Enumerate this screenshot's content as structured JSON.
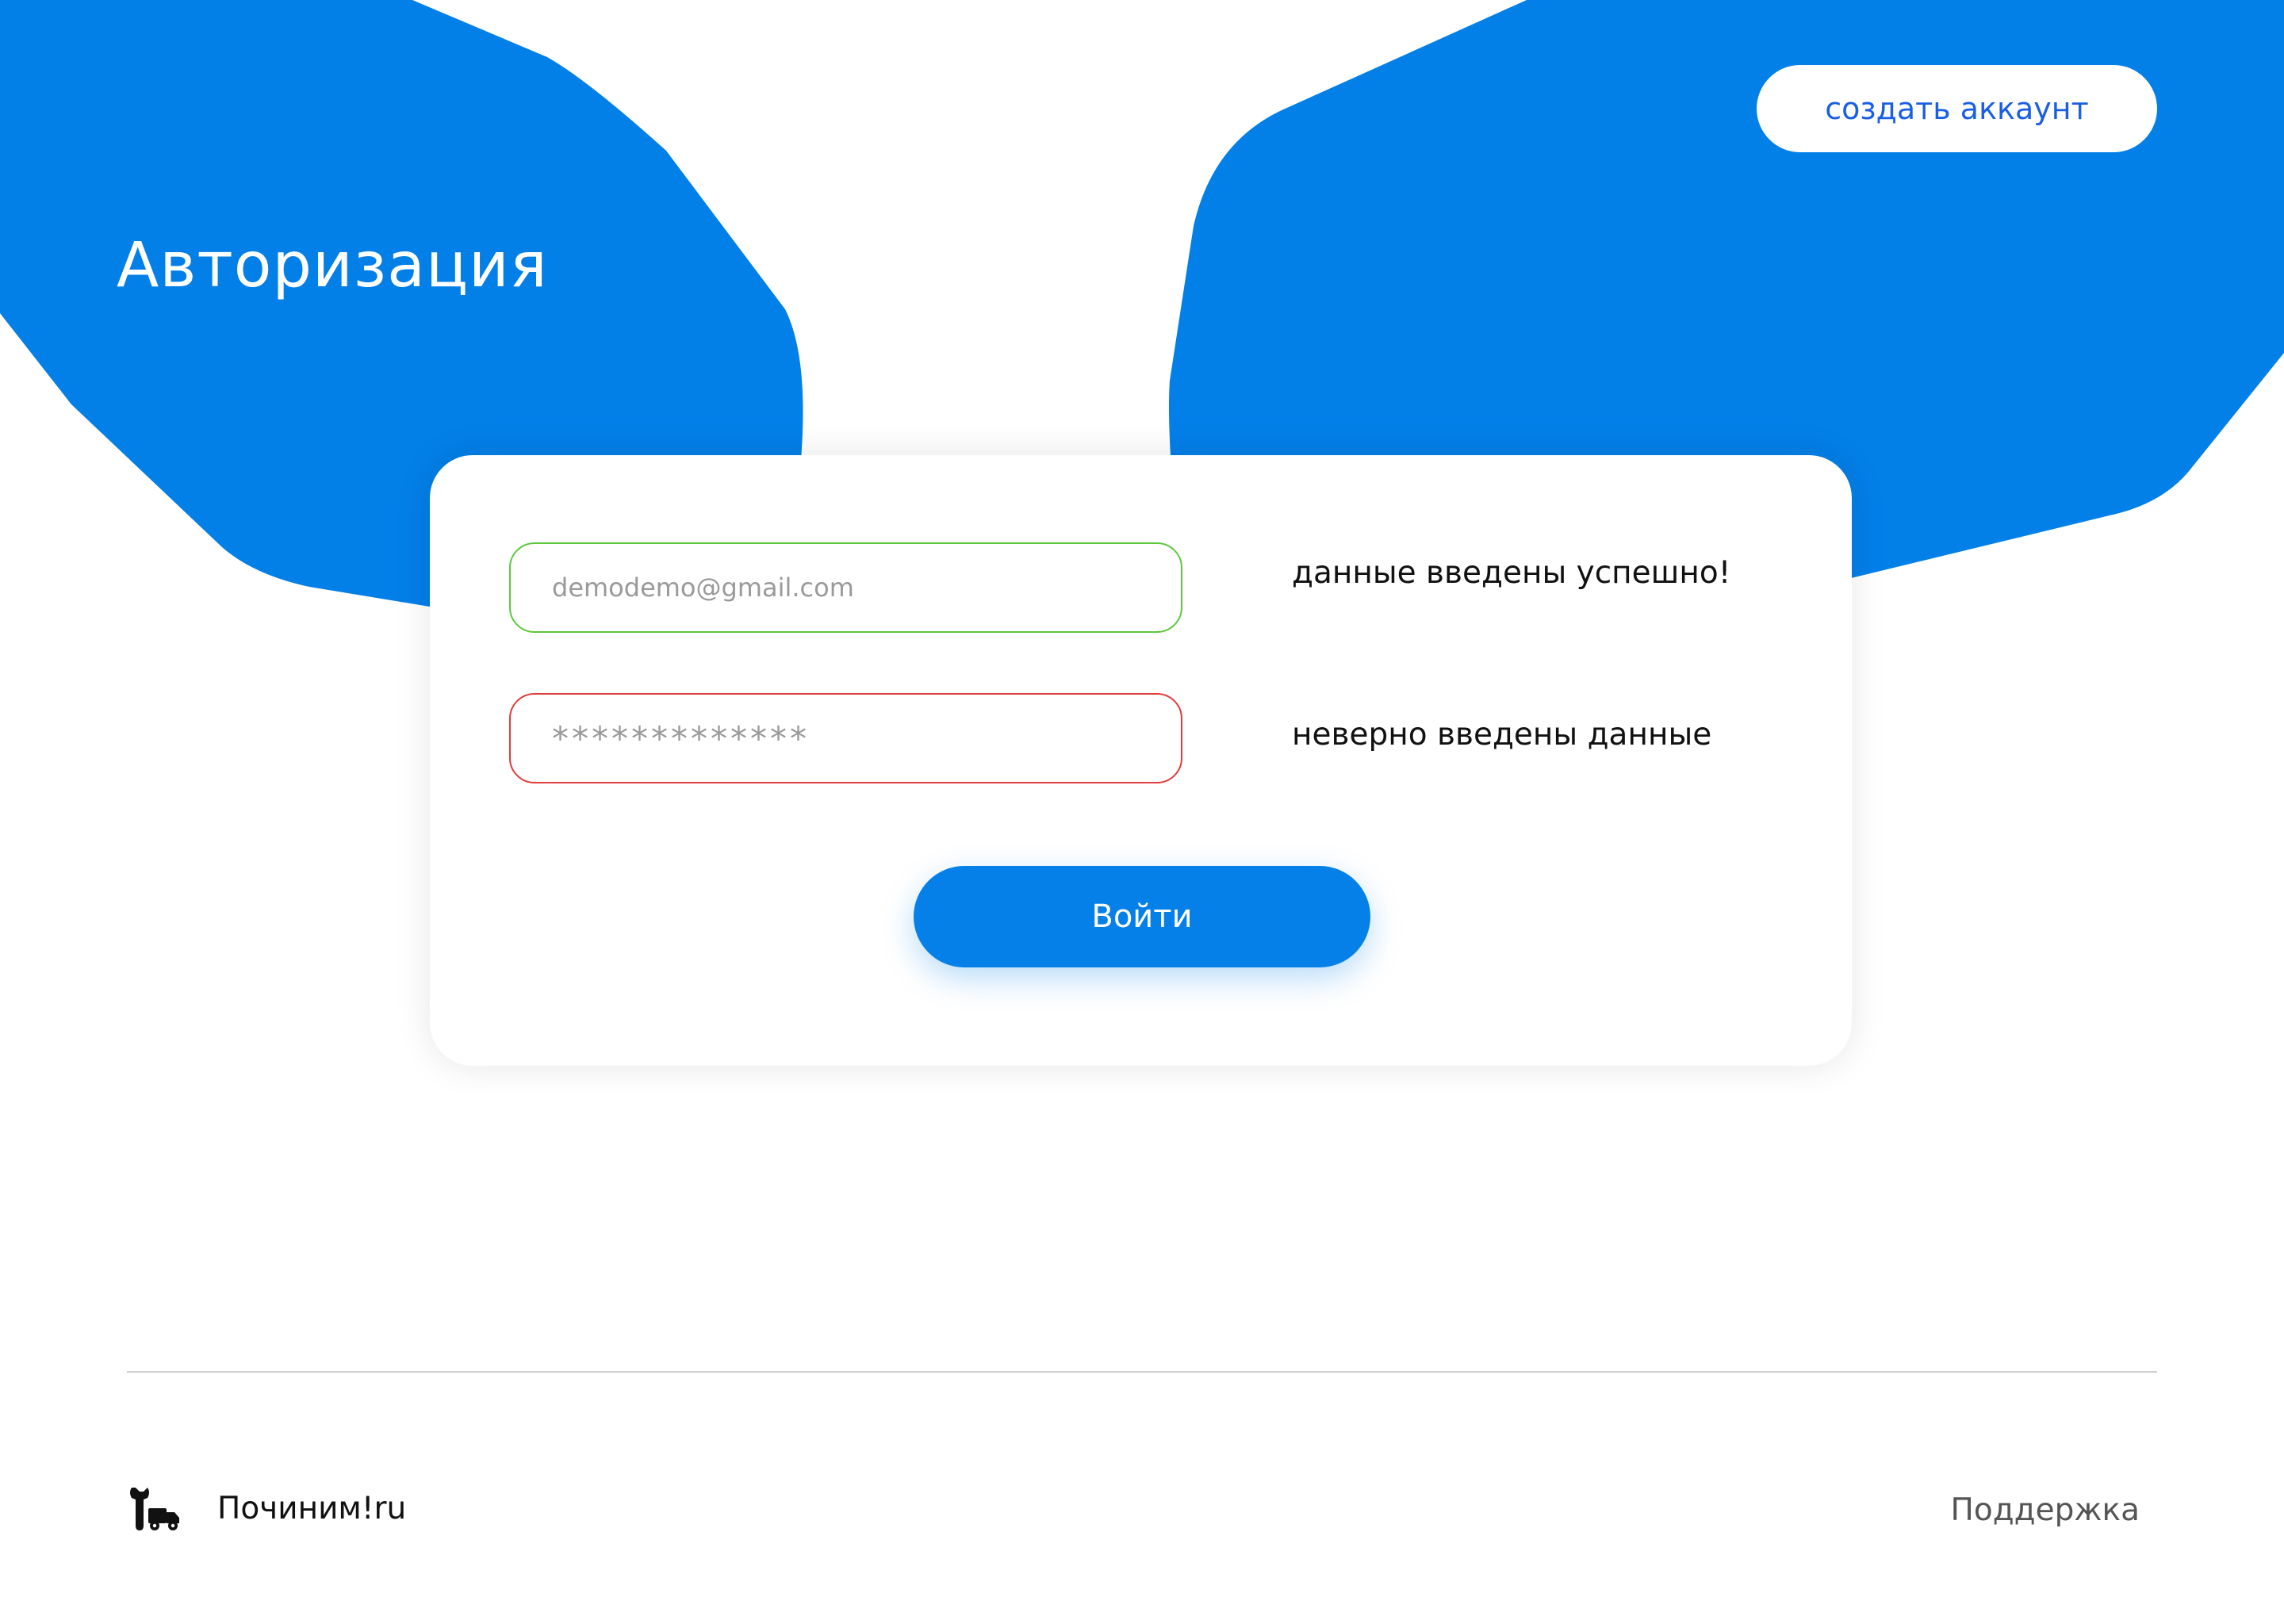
{
  "colors": {
    "brand_blue": "#0480e8",
    "link_blue": "#1a5ee6",
    "success_green": "#5cc83b",
    "error_red": "#e23b3b",
    "background": "#ffffff"
  },
  "header": {
    "title": "Авторизация",
    "create_account_label": "создать аккаунт"
  },
  "form": {
    "email_placeholder": "demodemo@gmail.com",
    "email_status": "данные введены успешно!",
    "password_value": "*************",
    "password_status": "неверно введены данные",
    "submit_label": "Войти"
  },
  "footer": {
    "logo_icon": "wrench-truck-icon",
    "brand": "Починим!ru",
    "support_label": "Поддержка"
  }
}
